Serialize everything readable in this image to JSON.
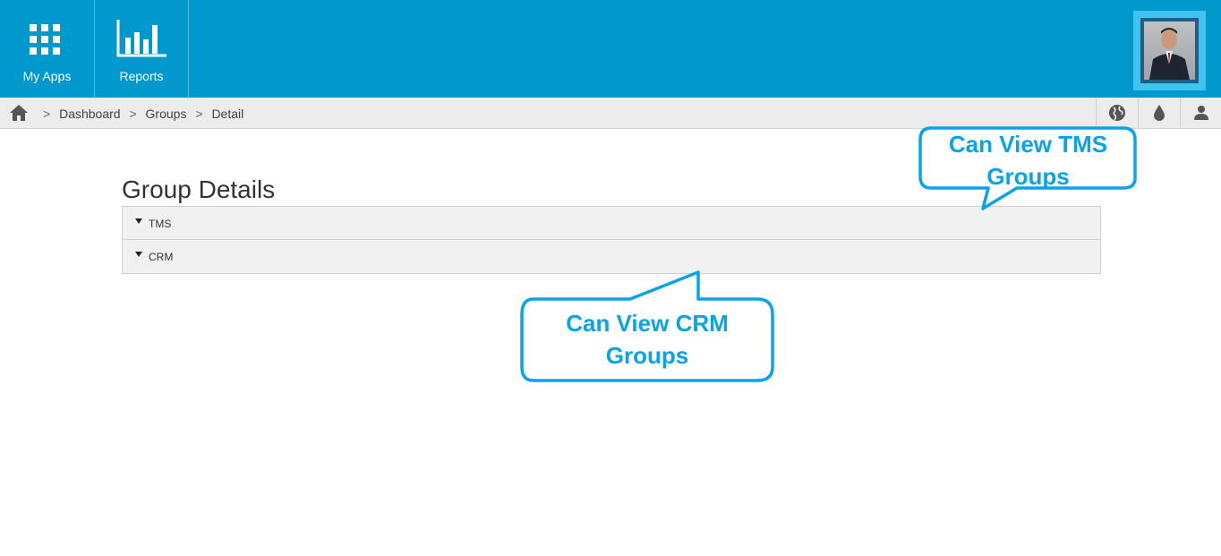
{
  "header": {
    "tiles": [
      {
        "label": "My Apps",
        "icon": "grid-apps-icon"
      },
      {
        "label": "Reports",
        "icon": "bar-chart-icon"
      }
    ],
    "avatar": {
      "icon": "user-photo-avatar"
    }
  },
  "breadcrumb": {
    "home_icon": "home-icon",
    "items": [
      "Dashboard",
      "Groups",
      "Detail"
    ],
    "separator": ">"
  },
  "toolbar": {
    "buttons": [
      {
        "icon": "globe-icon"
      },
      {
        "icon": "droplet-icon"
      },
      {
        "icon": "user-icon"
      }
    ]
  },
  "main": {
    "title": "Group Details",
    "accordion": [
      {
        "label": "TMS"
      },
      {
        "label": "CRM"
      }
    ]
  },
  "callouts": {
    "tms": {
      "line1": "Can View TMS",
      "line2": "Groups"
    },
    "crm": {
      "line1": "Can View CRM",
      "line2": "Groups"
    }
  },
  "colors": {
    "header_bg": "#0098cd",
    "callout_text": "#0aa3e8",
    "avatar_frame": "#3fc3ef"
  }
}
